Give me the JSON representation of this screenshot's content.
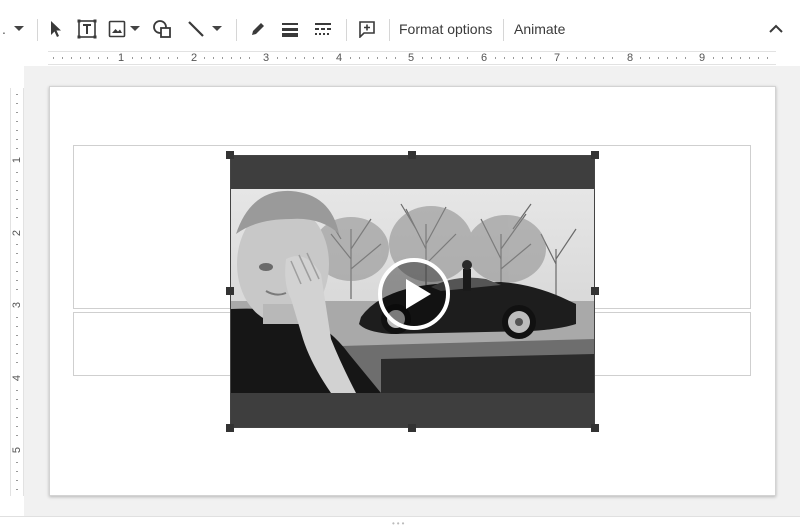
{
  "toolbar": {
    "leading": ".",
    "format_options": "Format options",
    "animate": "Animate"
  },
  "ruler": {
    "h_numbers": [
      "1",
      "2",
      "3",
      "4",
      "5",
      "6",
      "7",
      "8",
      "9"
    ],
    "v_numbers": [
      "1",
      "2",
      "3",
      "4",
      "5"
    ]
  },
  "icons": {
    "select": "cursor-arrow-icon",
    "textbox": "text-box-icon",
    "image": "image-icon",
    "shape": "shape-icon",
    "line": "line-icon",
    "pen": "pen-icon",
    "line_weight": "line-weight-icon",
    "line_dash": "line-dash-icon",
    "comment": "add-comment-icon",
    "collapse": "chevron-up-icon",
    "play": "play-icon"
  },
  "colors": {
    "toolbar_icon": "#444444",
    "workspace_bg": "#f1f1f1",
    "selection": "#333333"
  }
}
